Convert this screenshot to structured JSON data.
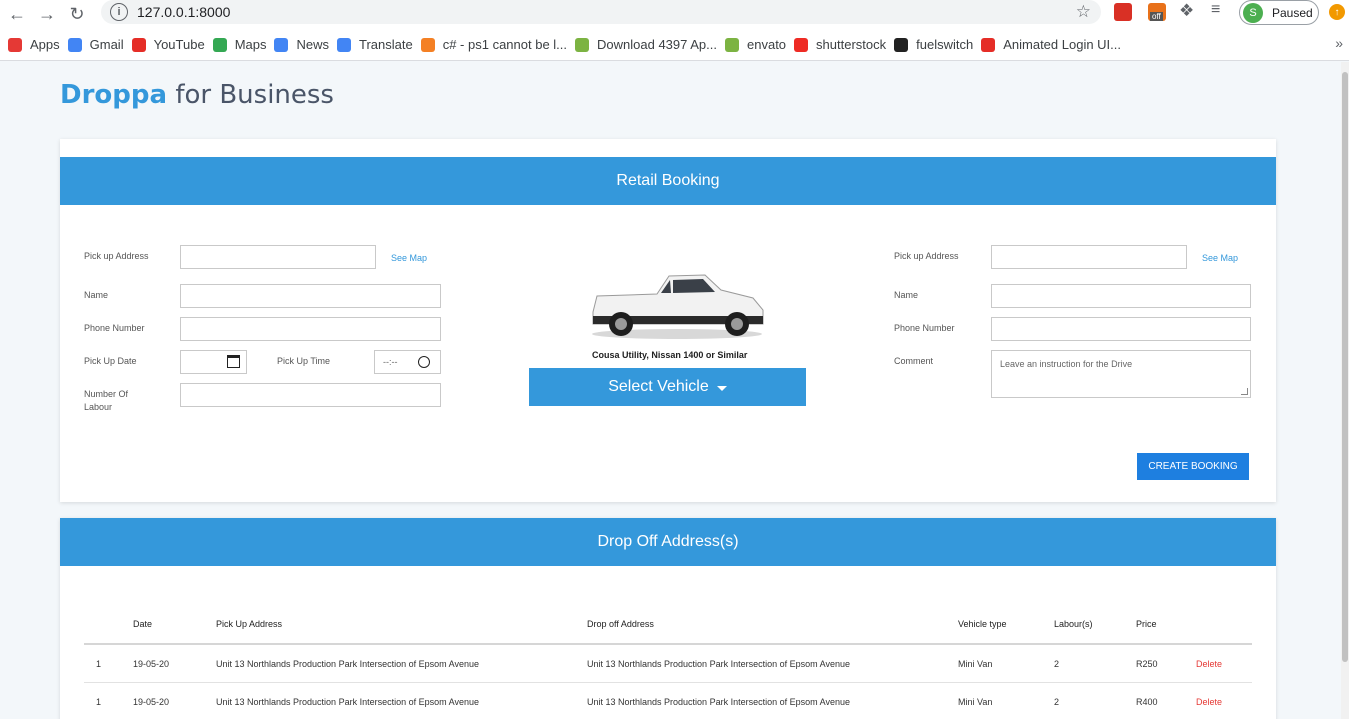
{
  "browser": {
    "url": "127.0.0.1:8000",
    "profile_initial": "S",
    "profile_status": "Paused",
    "bookmarks": [
      {
        "label": "Apps",
        "color": "#e53935"
      },
      {
        "label": "Gmail",
        "color": "#4285f4"
      },
      {
        "label": "YouTube",
        "color": "#e52d27"
      },
      {
        "label": "Maps",
        "color": "#34a853"
      },
      {
        "label": "News",
        "color": "#4285f4"
      },
      {
        "label": "Translate",
        "color": "#4285f4"
      },
      {
        "label": "c# - ps1 cannot be l...",
        "color": "#f48024"
      },
      {
        "label": "Download 4397 Ap...",
        "color": "#7cb342"
      },
      {
        "label": "envato",
        "color": "#7cb342"
      },
      {
        "label": "shutterstock",
        "color": "#ee2b24"
      },
      {
        "label": "fuelswitch",
        "color": "#222222"
      },
      {
        "label": "Animated Login UI...",
        "color": "#e52d27"
      }
    ]
  },
  "brand": {
    "name": "Droppa",
    "suffix": "for Business"
  },
  "booking": {
    "title": "Retail Booking",
    "left": {
      "pickup_label": "Pick up Address",
      "see_map": "See Map",
      "name_label": "Name",
      "phone_label": "Phone Number",
      "date_label": "Pick Up Date",
      "time_label": "Pick Up Time",
      "time_placeholder": "--:--",
      "labour_label": "Number Of Labour"
    },
    "vehicle": {
      "caption": "Cousa Utility, Nissan 1400 or Similar",
      "select_label": "Select Vehicle"
    },
    "right": {
      "pickup_label": "Pick up Address",
      "see_map": "See Map",
      "name_label": "Name",
      "phone_label": "Phone Number",
      "comment_label": "Comment",
      "comment_placeholder": "Leave an instruction for the Drive"
    },
    "create_label": "CREATE BOOKING"
  },
  "dropoff": {
    "title": "Drop Off Address(s)",
    "columns": [
      "Date",
      "Pick Up Address",
      "Drop off Address",
      "Vehicle type",
      "Labour(s)",
      "Price"
    ],
    "rows": [
      {
        "num": "1",
        "date": "19-05-20",
        "pickup": "Unit 13 Northlands Production Park Intersection of Epsom Avenue",
        "dropoff": "Unit 13 Northlands Production Park Intersection of Epsom Avenue",
        "vehicle": "Mini Van",
        "labour": "2",
        "price": "R250",
        "action": "Delete"
      },
      {
        "num": "1",
        "date": "19-05-20",
        "pickup": "Unit 13 Northlands Production Park Intersection of Epsom Avenue",
        "dropoff": "Unit 13 Northlands Production Park Intersection of Epsom Avenue",
        "vehicle": "Mini Van",
        "labour": "2",
        "price": "R400",
        "action": "Delete"
      }
    ]
  }
}
